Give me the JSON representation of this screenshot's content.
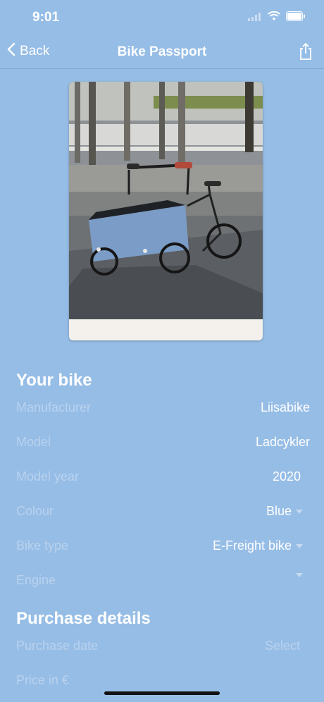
{
  "status": {
    "time": "9:01"
  },
  "nav": {
    "back_label": "Back",
    "title": "Bike Passport"
  },
  "bike_section": {
    "title": "Your bike",
    "rows": [
      {
        "label": "Manufacturer",
        "value": "Liisabike"
      },
      {
        "label": "Model",
        "value": "Ladcykler"
      },
      {
        "label": "Model year",
        "value": "2020"
      },
      {
        "label": "Colour",
        "value": "Blue"
      },
      {
        "label": "Bike type",
        "value": "E-Freight bike"
      },
      {
        "label": "Engine",
        "value": ""
      }
    ]
  },
  "purchase_section": {
    "title": "Purchase details",
    "rows": [
      {
        "label": "Purchase date",
        "value": "Select"
      },
      {
        "label": "Price in €",
        "value": ""
      }
    ]
  },
  "colors": {
    "background": "#96bde6",
    "text": "#ffffff",
    "label": "#b9d2ee"
  },
  "icons": [
    "wifi-icon",
    "battery-icon",
    "chevron-left-icon",
    "share-icon",
    "chevron-down-icon"
  ]
}
